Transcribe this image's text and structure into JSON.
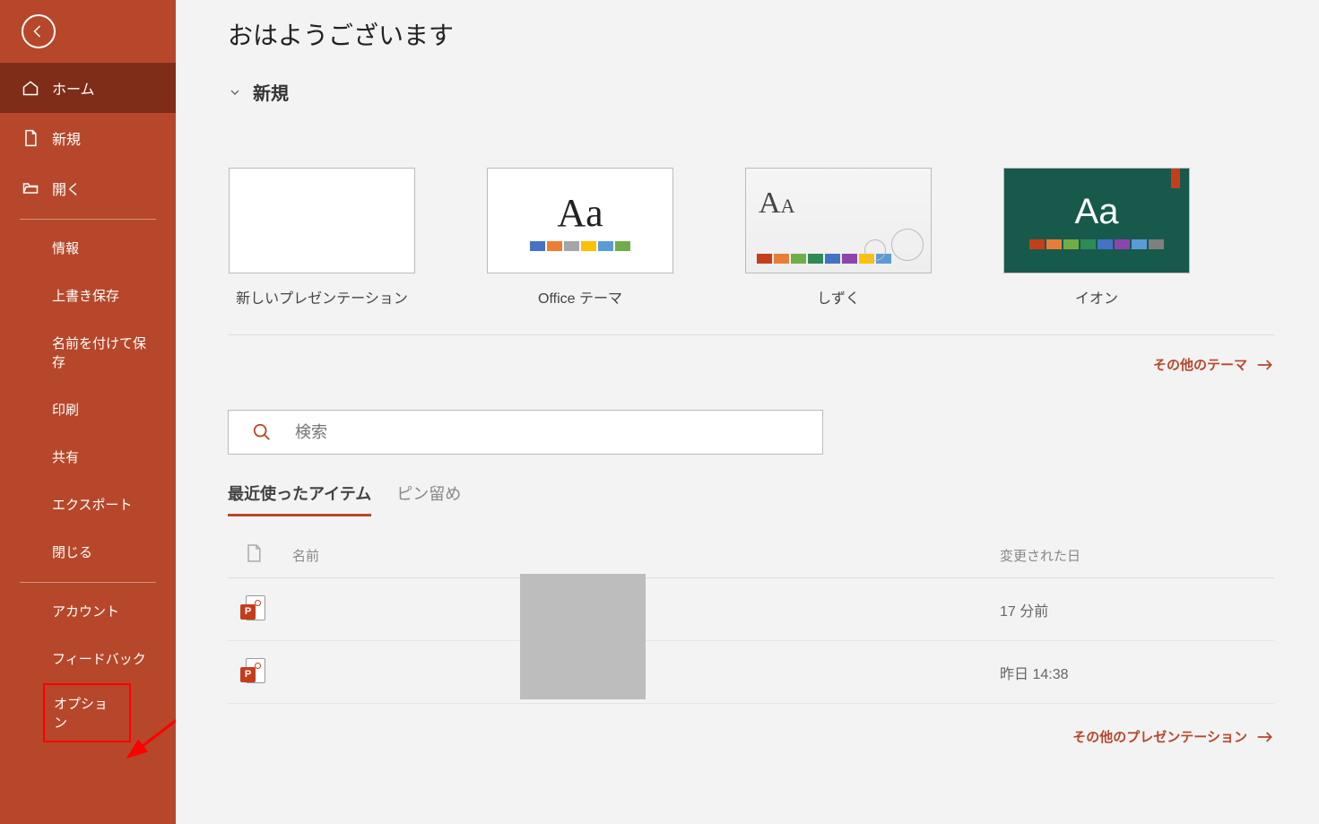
{
  "greeting": "おはようございます",
  "sidebar": {
    "home": "ホーム",
    "new": "新規",
    "open": "開く",
    "info": "情報",
    "save": "上書き保存",
    "saveAs": "名前を付けて保存",
    "print": "印刷",
    "share": "共有",
    "export": "エクスポート",
    "close": "閉じる",
    "account": "アカウント",
    "feedback": "フィードバック",
    "options": "オプション"
  },
  "newSection": {
    "header": "新規",
    "templates": [
      {
        "label": "新しいプレゼンテーション"
      },
      {
        "label": "Office テーマ"
      },
      {
        "label": "しずく"
      },
      {
        "label": "イオン"
      }
    ],
    "moreThemes": "その他のテーマ"
  },
  "search": {
    "placeholder": "検索"
  },
  "tabs": {
    "recent": "最近使ったアイテム",
    "pinned": "ピン留め"
  },
  "table": {
    "colName": "名前",
    "colDate": "変更された日",
    "rows": [
      {
        "modified": "17 分前"
      },
      {
        "modified": "昨日 14:38"
      }
    ]
  },
  "morePresentations": "その他のプレゼンテーション"
}
